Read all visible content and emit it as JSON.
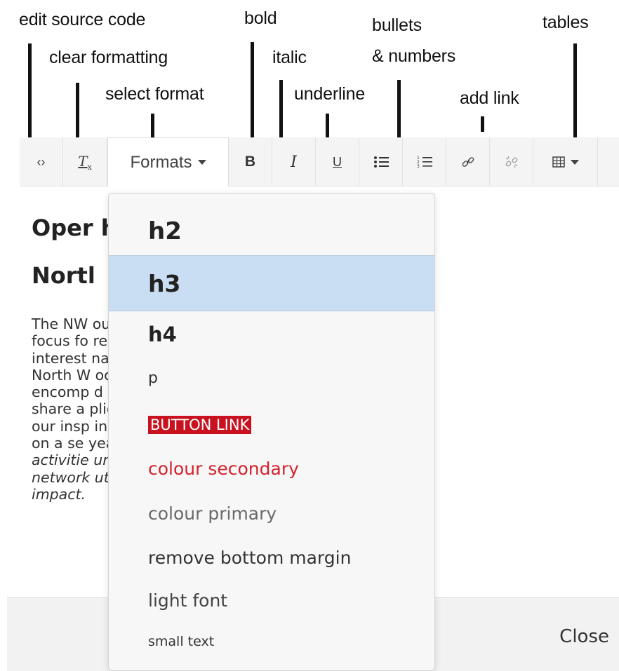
{
  "annotations": {
    "edit_source_code": "edit source code",
    "clear_formatting": "clear formatting",
    "select_format": "select format",
    "bold": "bold",
    "italic": "italic",
    "underline": "underline",
    "bullets_line1": "bullets",
    "bullets_line2": "& numbers",
    "add_link": "add link",
    "tables": "tables"
  },
  "toolbar": {
    "source_code_icon": "code-icon",
    "clear_formatting_icon": "clear-formatting-icon",
    "formats_label": "Formats",
    "bold_label": "B",
    "italic_label": "I",
    "underline_label": "U",
    "bullet_list_icon": "bullet-list-icon",
    "numbered_list_icon": "numbered-list-icon",
    "link_icon": "link-icon",
    "unlink_icon": "unlink-icon",
    "table_icon": "table-icon"
  },
  "content": {
    "heading_line1": "Oper                             hin the",
    "heading_line2": "Nortl",
    "paragraph_lines": [
      "The NW                              our aim is to provi",
      "focus fo                               reach out to anyo",
      "interest                              nal research here i",
      "North W                              ociety members,",
      "encomp                              d academics alike,",
      "share a                               plication of OR. We",
      "our insp                              in the region and p",
      "on a se                               year to support O",
      "activitie                               unities to expand y",
      "network                              utilising OR with",
      "impact."
    ]
  },
  "formats_menu": {
    "items": [
      "h2",
      "h3",
      "h4",
      "p",
      "BUTTON LINK",
      "colour secondary",
      "colour primary",
      "remove bottom margin",
      "light font",
      "small text"
    ],
    "selected": "h3"
  },
  "footer": {
    "close_label": "Close"
  },
  "colors": {
    "accent_red": "#c9121f",
    "selected_bg": "#c9ddf3"
  }
}
